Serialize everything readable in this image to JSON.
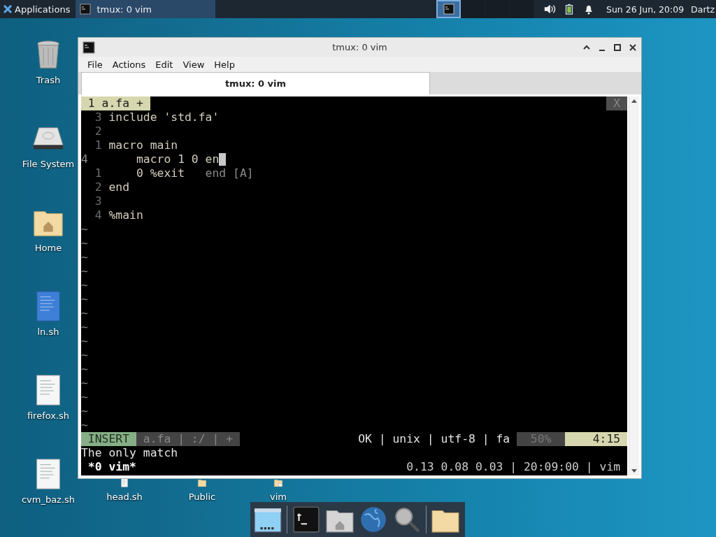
{
  "top_panel": {
    "applications": "Applications",
    "tasks": [
      {
        "title": "tmux: 0 vim",
        "selected": true
      }
    ],
    "workspaces": [
      {
        "selected": true
      },
      {
        "selected": false
      },
      {
        "selected": false
      },
      {
        "selected": false
      }
    ],
    "clock": "Sun 26 Jun, 20:09",
    "user": "Dartz"
  },
  "desktop_icons": [
    {
      "label": "Trash",
      "kind": "trash"
    },
    {
      "label": "File System",
      "kind": "drive"
    },
    {
      "label": "Home",
      "kind": "home"
    },
    {
      "label": "ln.sh",
      "kind": "script"
    },
    {
      "label": "firefox.sh",
      "kind": "doc"
    },
    {
      "label": "cvm_baz.sh",
      "kind": "doc"
    },
    {
      "label": "head.sh",
      "kind": "doc"
    },
    {
      "label": "Public",
      "kind": "folder"
    },
    {
      "label": "vim",
      "kind": "vimfile"
    }
  ],
  "window": {
    "title": "tmux: 0 vim",
    "menu": [
      "File",
      "Actions",
      "Edit",
      "View",
      "Help"
    ],
    "tabs": [
      {
        "label": "tmux: 0 vim",
        "selected": true
      }
    ],
    "vim": {
      "tab": "1 a.fa +",
      "tab_close": "X",
      "lines": [
        {
          "number": "3",
          "text": "include 'std.fa'",
          "cursor": false
        },
        {
          "number": "2",
          "cursor": false
        },
        {
          "number": "1",
          "text": "macro main",
          "cursor": false
        },
        {
          "number": "4",
          "text": "    macro 1 0 en",
          "cursor": true
        },
        {
          "number": "1",
          "text": "    0 %exit   ",
          "ghost": "end [A]",
          "cursor": false
        },
        {
          "number": "2",
          "text": "end",
          "cursor": false
        },
        {
          "number": "3",
          "cursor": false
        },
        {
          "number": "4",
          "text": "%main",
          "cursor": false
        }
      ],
      "filler": [
        "~",
        "~",
        "~",
        "~",
        "~",
        "~",
        "~",
        "~",
        "~",
        "~",
        "~",
        "~",
        "~",
        "~",
        "~"
      ],
      "status": {
        "mode": "INSERT",
        "file": "a.fa | :/ | +",
        "info": "OK | unix | utf-8 | fa",
        "percent": "50%",
        "position": "4:15"
      },
      "message": "The only match"
    },
    "tmux": {
      "window": "*0 vim*",
      "right": "0.13 0.08 0.03 | 20:09:00 | vim"
    }
  },
  "dock": [
    {
      "kind": "show-desktop"
    },
    {
      "kind": "terminal"
    },
    {
      "kind": "home"
    },
    {
      "kind": "browser"
    },
    {
      "kind": "search"
    },
    {
      "kind": "folder"
    }
  ]
}
